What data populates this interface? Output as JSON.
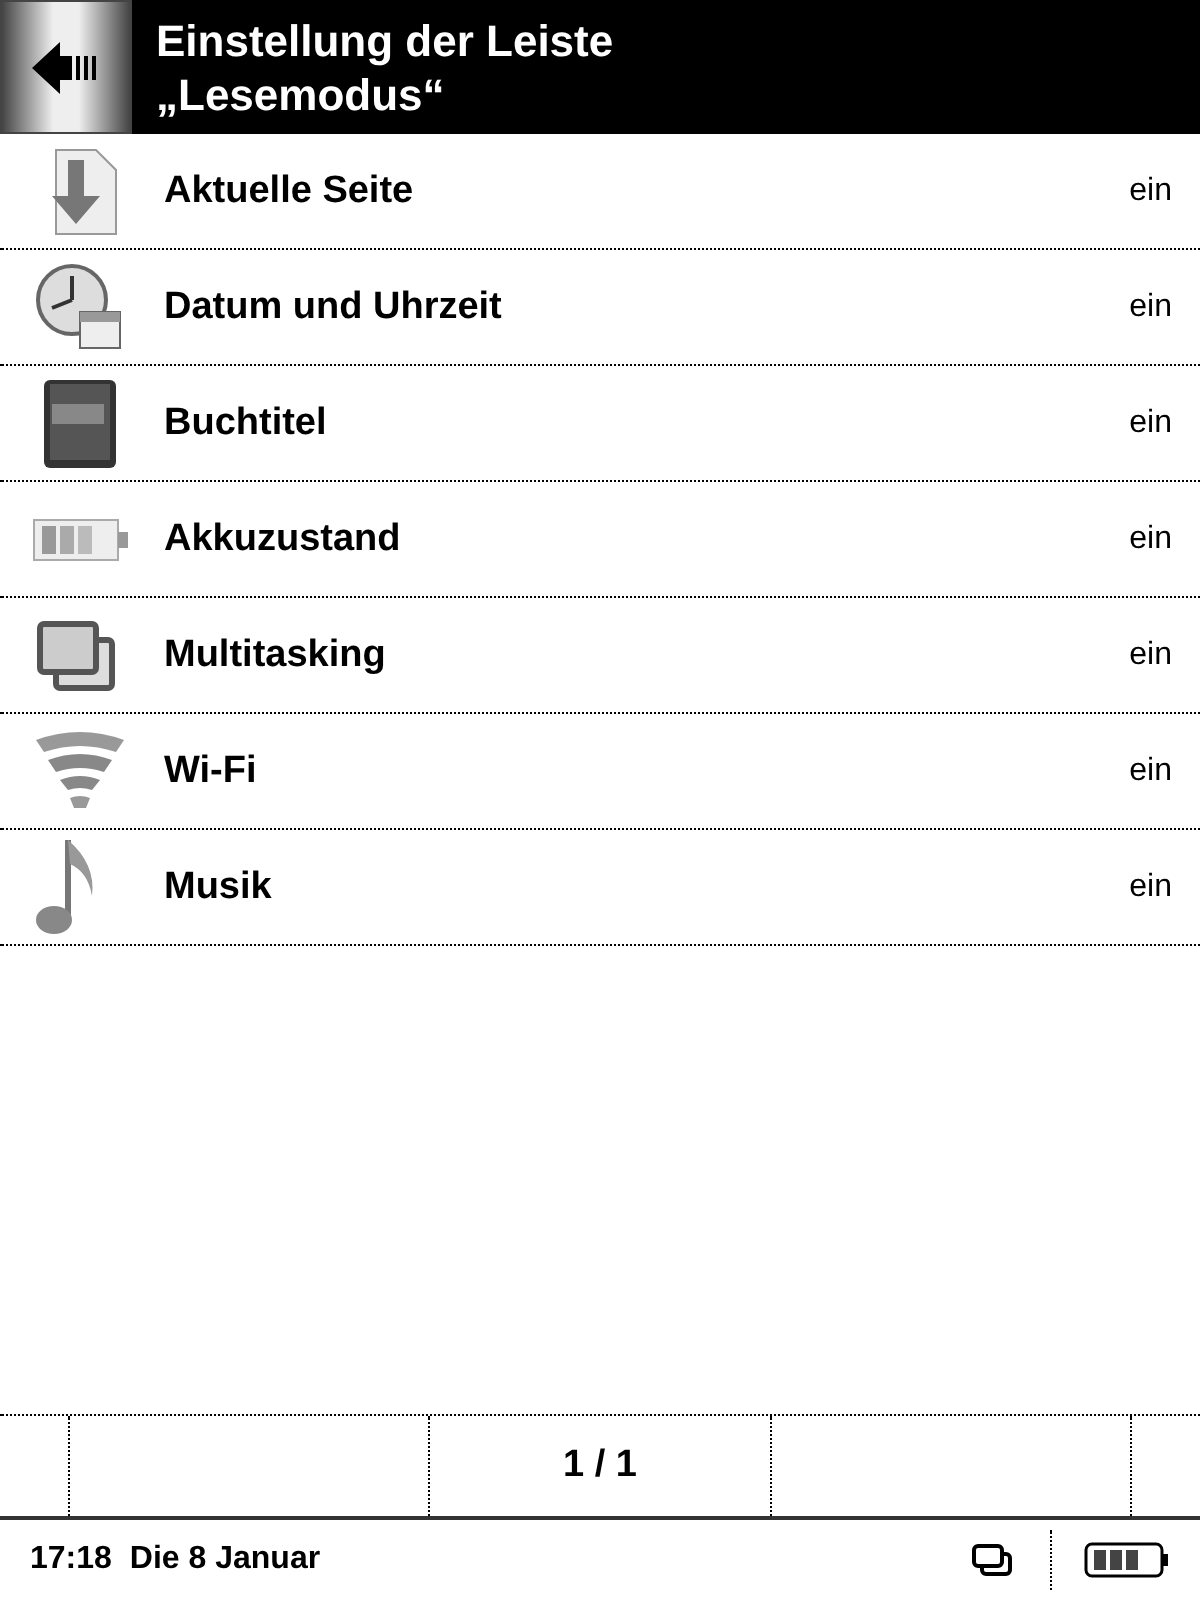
{
  "header": {
    "title": "Einstellung der Leiste\n„Lesemodus“"
  },
  "items": [
    {
      "kind": "page",
      "label": "Aktuelle Seite",
      "value": "ein"
    },
    {
      "kind": "clock",
      "label": "Datum und Uhrzeit",
      "value": "ein"
    },
    {
      "kind": "book",
      "label": "Buchtitel",
      "value": "ein"
    },
    {
      "kind": "battery",
      "label": "Akkuzustand",
      "value": "ein"
    },
    {
      "kind": "windows",
      "label": "Multitasking",
      "value": "ein"
    },
    {
      "kind": "wifi",
      "label": "Wi-Fi",
      "value": "ein"
    },
    {
      "kind": "music",
      "label": "Musik",
      "value": "ein"
    }
  ],
  "pager": {
    "text": "1 / 1"
  },
  "status_bar": {
    "time": "17:18",
    "date": "Die 8 Januar"
  }
}
